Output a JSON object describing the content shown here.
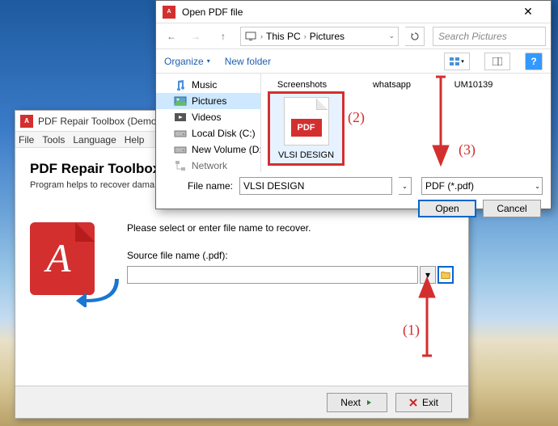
{
  "bg": {
    "title": "PDF Repair Toolbox (Demo version)",
    "menu": {
      "file": "File",
      "tools": "Tools",
      "language": "Language",
      "help": "Help"
    },
    "heading": "PDF Repair Toolbox",
    "subtext": "Program helps to recover dama",
    "instruction": "Please select or enter file name to recover.",
    "source_label": "Source file name (.pdf):",
    "source_value": "",
    "next": "Next",
    "exit": "Exit"
  },
  "dlg": {
    "title": "Open PDF file",
    "breadcrumb": {
      "pc": "This PC",
      "folder": "Pictures"
    },
    "search_placeholder": "Search Pictures",
    "organize": "Organize",
    "new_folder": "New folder",
    "sidebar": {
      "music": "Music",
      "pictures": "Pictures",
      "videos": "Videos",
      "localdisk": "Local Disk (C:)",
      "newvolume": "New Volume (D:",
      "network": "Network"
    },
    "files": {
      "screenshots": "Screenshots",
      "whatsapp": "whatsapp",
      "um": "UM10139",
      "vlsi": "VLSI DESIGN",
      "pdf_badge": "PDF"
    },
    "filename_label": "File name:",
    "filename_value": "VLSI DESIGN",
    "filetype": "PDF (*.pdf)",
    "open": "Open",
    "cancel": "Cancel"
  },
  "anno": {
    "one": "(1)",
    "two": "(2)",
    "three": "(3)"
  }
}
